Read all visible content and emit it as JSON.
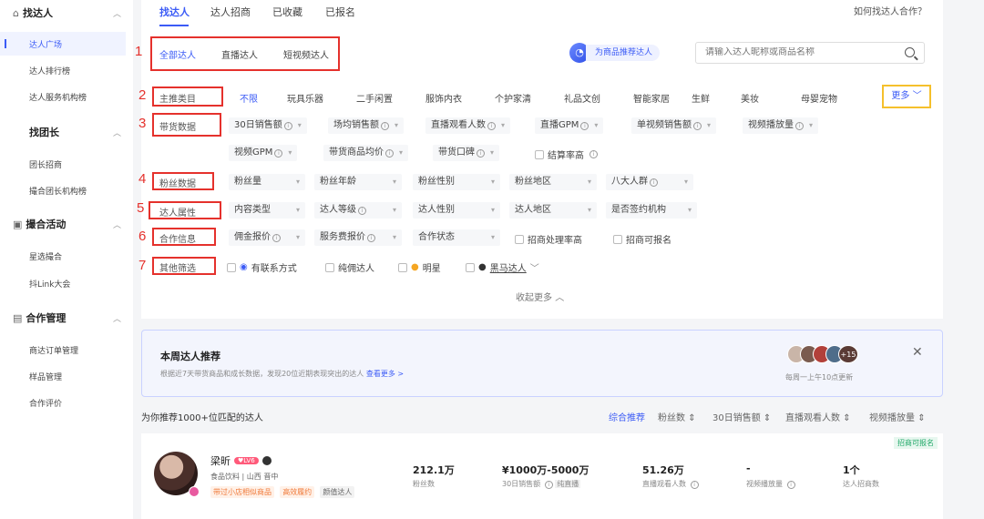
{
  "sidebar": {
    "groups": [
      {
        "label": "找达人",
        "items": [
          "达人广场",
          "达人排行榜",
          "达人服务机构榜"
        ]
      },
      {
        "label": "找团长",
        "items": [
          "团长招商",
          "撮合团长机构榜"
        ]
      },
      {
        "label": "撮合活动",
        "items": [
          "星选撮合",
          "抖Link大会"
        ]
      },
      {
        "label": "合作管理",
        "items": [
          "商达订单管理",
          "样品管理",
          "合作评价"
        ]
      }
    ]
  },
  "tabs": [
    "找达人",
    "达人招商",
    "已收藏",
    "已报名"
  ],
  "help_link": "如何找达人合作？",
  "annotations": [
    "1",
    "2",
    "3",
    "4",
    "5",
    "6",
    "7"
  ],
  "types": [
    "全部达人",
    "直播达人",
    "短视频达人"
  ],
  "recommend_label": "为商品推荐达人",
  "search": {
    "placeholder": "请输入达人昵称或商品名称"
  },
  "filters": {
    "category": {
      "label": "主推类目",
      "options": [
        "不限",
        "玩具乐器",
        "二手闲置",
        "服饰内衣",
        "个护家清",
        "礼品文创",
        "智能家居",
        "生鲜",
        "美妆",
        "母婴宠物"
      ],
      "more": "更多"
    },
    "sales": {
      "label": "带货数据",
      "row1": [
        "30日销售额",
        "场均销售额",
        "直播观看人数",
        "直播GPM",
        "单视频销售额",
        "视频播放量"
      ],
      "row2": [
        "视频GPM",
        "带货商品均价",
        "带货口碑"
      ],
      "checkbox": "结算率高"
    },
    "fans": {
      "label": "粉丝数据",
      "options": [
        "粉丝量",
        "粉丝年龄",
        "粉丝性别",
        "粉丝地区",
        "八大人群"
      ]
    },
    "attrs": {
      "label": "达人属性",
      "options": [
        "内容类型",
        "达人等级",
        "达人性别",
        "达人地区",
        "是否签约机构"
      ]
    },
    "coop": {
      "label": "合作信息",
      "options": [
        "佣金报价",
        "服务费报价",
        "合作状态"
      ],
      "checkboxes": [
        "招商处理率高",
        "招商可报名"
      ]
    },
    "other": {
      "label": "其他筛选",
      "checkboxes": [
        "有联系方式",
        "纯佣达人",
        "明星",
        "黑马达人"
      ]
    }
  },
  "collapse_label": "收起更多",
  "weekly": {
    "title": "本周达人推荐",
    "desc": "根据近7天带货商品和成长数据，发现20位近期表现突出的达人",
    "link": "查看更多 >",
    "badge": "+15",
    "note": "每周一上午10点更新"
  },
  "results_summary": "为你推荐1000+位匹配的达人",
  "sort_options": [
    "综合推荐",
    "粉丝数",
    "30日销售额",
    "直播观看人数",
    "视频播放量"
  ],
  "creator": {
    "name": "梁昕",
    "level": "LV6",
    "category": "食品饮料",
    "location": "山西 晋中",
    "tags": [
      "带过小店相似商品",
      "高效履约",
      "颜值达人"
    ],
    "badge": "招商可报名",
    "stats": [
      {
        "value": "212.1万",
        "label": "粉丝数"
      },
      {
        "value": "¥1000万-5000万",
        "label": "30日销售额",
        "extra": "纯直播"
      },
      {
        "value": "51.26万",
        "label": "直播观看人数"
      },
      {
        "value": "-",
        "label": "视频播放量"
      },
      {
        "value": "1个",
        "label": "达人招商数"
      }
    ]
  }
}
